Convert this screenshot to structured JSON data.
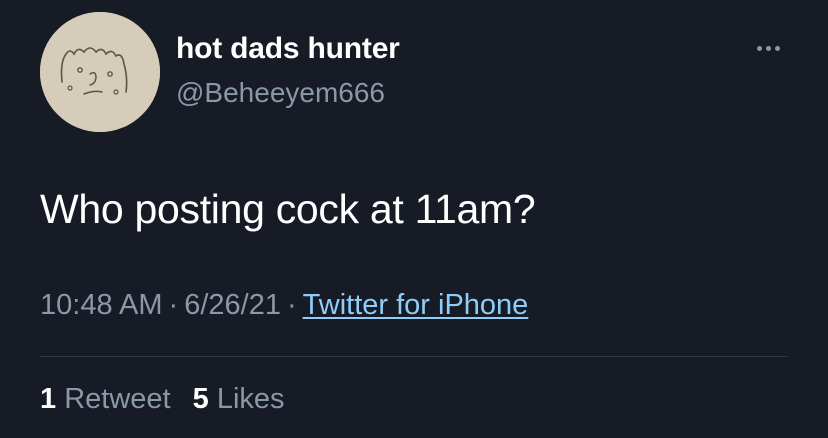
{
  "user": {
    "display_name": "hot dads hunter",
    "handle": "@Beheeyem666"
  },
  "tweet": {
    "text": "Who posting cock at 11am?"
  },
  "meta": {
    "time": "10:48 AM",
    "date": "6/26/21",
    "separator": "·",
    "source": "Twitter for iPhone"
  },
  "stats": {
    "retweets_count": "1",
    "retweets_label": "Retweet",
    "likes_count": "5",
    "likes_label": "Likes"
  },
  "icons": {
    "more": "more-horizontal-icon"
  },
  "colors": {
    "background": "#161b25",
    "primary_text": "#ffffff",
    "secondary_text": "#8b98a5",
    "link": "#8ecdf8",
    "divider": "#2f3642"
  }
}
